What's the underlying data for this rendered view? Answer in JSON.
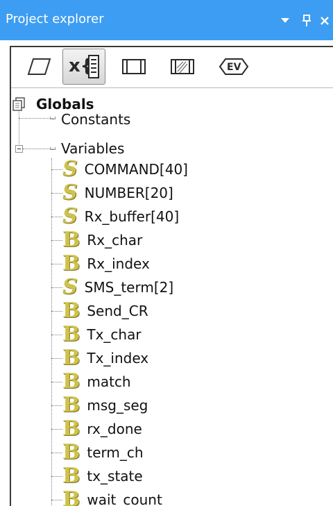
{
  "window": {
    "title": "Project explorer",
    "controls": [
      "chevron-down-icon",
      "pin-icon",
      "close-icon"
    ]
  },
  "toolbar": {
    "tools": [
      {
        "icon": "parallelogram-icon",
        "active": false
      },
      {
        "icon": "variables-icon",
        "label": "x{",
        "active": true
      },
      {
        "icon": "module-icon",
        "active": false
      },
      {
        "icon": "hatched-module-icon",
        "active": false
      },
      {
        "icon": "event-icon",
        "label": "EV",
        "active": false
      }
    ]
  },
  "tree": {
    "root": {
      "label": "Globals",
      "icon": "globals-icon"
    },
    "groups": [
      {
        "label": "Constants"
      },
      {
        "label": "Variables"
      }
    ],
    "variables": [
      {
        "type": "S",
        "label": "COMMAND[40]"
      },
      {
        "type": "S",
        "label": "NUMBER[20]"
      },
      {
        "type": "S",
        "label": "Rx_buffer[40]"
      },
      {
        "type": "B",
        "label": "Rx_char"
      },
      {
        "type": "B",
        "label": "Rx_index"
      },
      {
        "type": "S",
        "label": "SMS_term[2]"
      },
      {
        "type": "B",
        "label": "Send_CR"
      },
      {
        "type": "B",
        "label": "Tx_char"
      },
      {
        "type": "B",
        "label": "Tx_index"
      },
      {
        "type": "B",
        "label": "match"
      },
      {
        "type": "B",
        "label": "msg_seg"
      },
      {
        "type": "B",
        "label": "rx_done"
      },
      {
        "type": "B",
        "label": "term_ch"
      },
      {
        "type": "B",
        "label": "tx_state"
      },
      {
        "type": "B",
        "label": "wait_count"
      }
    ]
  },
  "colors": {
    "titlebar": "#3d9df2",
    "typeIcon": "#cfc24a"
  }
}
